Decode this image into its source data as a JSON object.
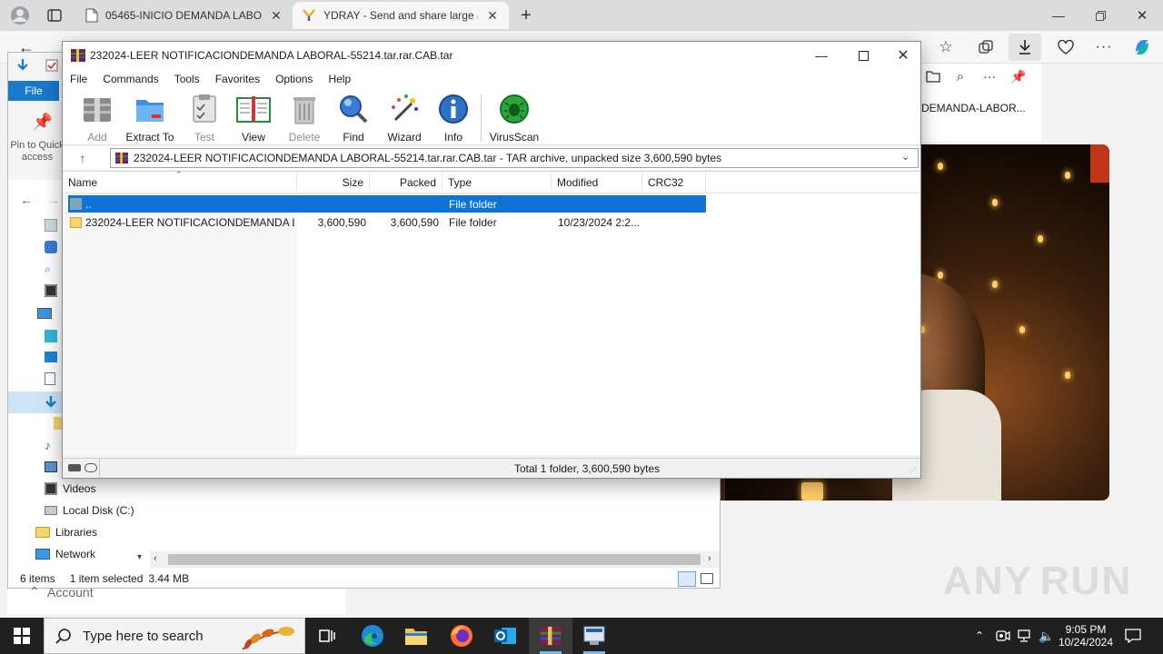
{
  "browser": {
    "tabs": [
      {
        "title": "05465-INICIO DEMANDA LABOR",
        "active": false
      },
      {
        "title": "YDRAY - Send and share large an",
        "active": true
      }
    ],
    "page_snippet": "DEMANDA-LABOR..."
  },
  "explorer": {
    "file_tab": "File",
    "pin_label": "Pin to Quick access",
    "nav_items": [
      {
        "label": "Videos"
      },
      {
        "label": "Local Disk (C:)"
      },
      {
        "label": "Libraries"
      },
      {
        "label": "Network"
      }
    ],
    "status_items": "6 items",
    "status_selected": "1 item selected",
    "status_size": "3.44 MB",
    "account_label": "Account"
  },
  "rar": {
    "title": "232024-LEER NOTIFICACIONDEMANDA LABORAL-55214.tar.rar.CAB.tar",
    "menu": [
      "File",
      "Commands",
      "Tools",
      "Favorites",
      "Options",
      "Help"
    ],
    "toolbar": [
      {
        "label": "Add",
        "icon": "add-archive-icon",
        "enabled": false
      },
      {
        "label": "Extract To",
        "icon": "extract-folder-icon",
        "enabled": true
      },
      {
        "label": "Test",
        "icon": "test-clipboard-icon",
        "enabled": false
      },
      {
        "label": "View",
        "icon": "view-book-icon",
        "enabled": true
      },
      {
        "label": "Delete",
        "icon": "trash-icon",
        "enabled": false
      },
      {
        "label": "Find",
        "icon": "magnifier-icon",
        "enabled": true
      },
      {
        "label": "Wizard",
        "icon": "wizard-wand-icon",
        "enabled": true
      },
      {
        "label": "Info",
        "icon": "info-icon",
        "enabled": true
      },
      {
        "label": "VirusScan",
        "icon": "virus-scan-icon",
        "enabled": true
      }
    ],
    "path": "232024-LEER NOTIFICACIONDEMANDA LABORAL-55214.tar.rar.CAB.tar - TAR archive, unpacked size 3,600,590 bytes",
    "columns": [
      "Name",
      "Size",
      "Packed",
      "Type",
      "Modified",
      "CRC32"
    ],
    "rows": [
      {
        "name": "..",
        "size": "",
        "packed": "",
        "type": "File folder",
        "modified": "",
        "crc": "",
        "selected": true
      },
      {
        "name": "232024-LEER NOTIFICACIONDEMANDA L...",
        "size": "3,600,590",
        "packed": "3,600,590",
        "type": "File folder",
        "modified": "10/23/2024 2:2...",
        "crc": "",
        "selected": false
      }
    ],
    "status_total": "Total 1 folder, 3,600,590 bytes"
  },
  "taskbar": {
    "search_placeholder": "Type here to search",
    "time": "9:05 PM",
    "date": "10/24/2024"
  },
  "watermark": {
    "left": "ANY",
    "right": "RUN"
  },
  "colors": {
    "selection": "#0f73d6",
    "explorer_accent": "#1979ca",
    "taskbar": "#202020"
  }
}
